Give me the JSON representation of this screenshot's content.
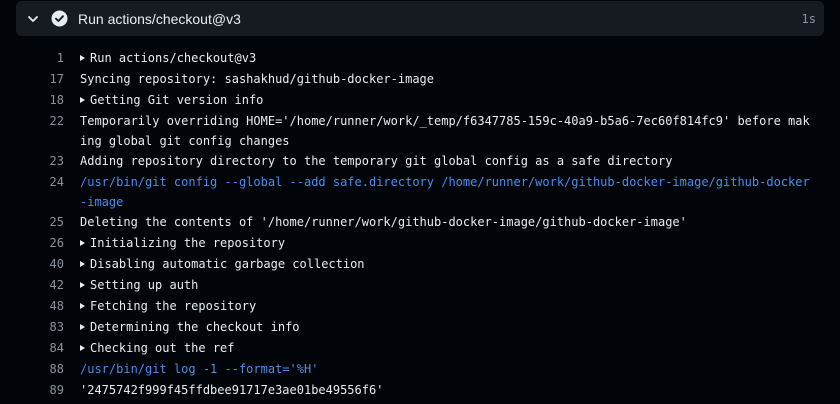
{
  "step": {
    "title": "Run actions/checkout@v3",
    "duration": "1s"
  },
  "colors": {
    "background": "#010409",
    "header_bg": "#161b22",
    "text": "#e6edf3",
    "line_number": "#8b949e",
    "command": "#4b8eed"
  },
  "log": {
    "l1": {
      "num": "1",
      "text": "Run actions/checkout@v3"
    },
    "l17": {
      "num": "17",
      "text": "Syncing repository: sashakhud/github-docker-image"
    },
    "l18": {
      "num": "18",
      "text": "Getting Git version info"
    },
    "l22": {
      "num": "22",
      "text": "Temporarily overriding HOME='/home/runner/work/_temp/f6347785-159c-40a9-b5a6-7ec60f814fc9' before making global git config changes"
    },
    "l23": {
      "num": "23",
      "text": "Adding repository directory to the temporary git global config as a safe directory"
    },
    "l24": {
      "num": "24",
      "text": "/usr/bin/git config --global --add safe.directory /home/runner/work/github-docker-image/github-docker-image"
    },
    "l25": {
      "num": "25",
      "text": "Deleting the contents of '/home/runner/work/github-docker-image/github-docker-image'"
    },
    "l26": {
      "num": "26",
      "text": "Initializing the repository"
    },
    "l40": {
      "num": "40",
      "text": "Disabling automatic garbage collection"
    },
    "l42": {
      "num": "42",
      "text": "Setting up auth"
    },
    "l48": {
      "num": "48",
      "text": "Fetching the repository"
    },
    "l83": {
      "num": "83",
      "text": "Determining the checkout info"
    },
    "l84": {
      "num": "84",
      "text": "Checking out the ref"
    },
    "l88": {
      "num": "88",
      "text": "/usr/bin/git log -1 --format='%H'"
    },
    "l89": {
      "num": "89",
      "text": "'2475742f999f45ffdbee91717e3ae01be49556f6'"
    }
  }
}
